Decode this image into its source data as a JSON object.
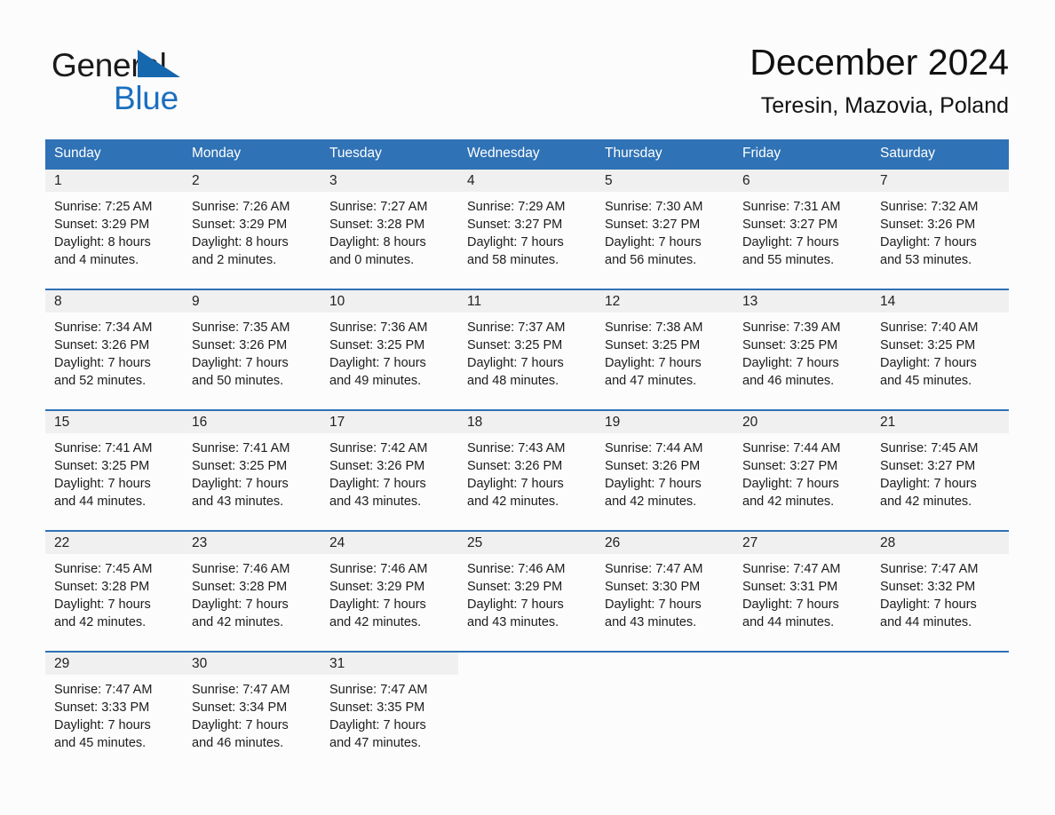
{
  "brand": {
    "line1": "General",
    "line2": "Blue",
    "triangle_color": "#1567ae",
    "blue_text_color": "#1b6fc0"
  },
  "header": {
    "title": "December 2024",
    "location": "Teresin, Mazovia, Poland"
  },
  "colors": {
    "header_blue": "#2f72b5",
    "daynum_band": "#f0f0f0",
    "page_background": "#fcfcfc",
    "text": "#1c1c1c"
  },
  "weekday_headers": [
    "Sunday",
    "Monday",
    "Tuesday",
    "Wednesday",
    "Thursday",
    "Friday",
    "Saturday"
  ],
  "weeks": [
    {
      "days": [
        {
          "num": "1",
          "sunrise": "Sunrise: 7:25 AM",
          "sunset": "Sunset: 3:29 PM",
          "daylight1": "Daylight: 8 hours",
          "daylight2": "and 4 minutes."
        },
        {
          "num": "2",
          "sunrise": "Sunrise: 7:26 AM",
          "sunset": "Sunset: 3:29 PM",
          "daylight1": "Daylight: 8 hours",
          "daylight2": "and 2 minutes."
        },
        {
          "num": "3",
          "sunrise": "Sunrise: 7:27 AM",
          "sunset": "Sunset: 3:28 PM",
          "daylight1": "Daylight: 8 hours",
          "daylight2": "and 0 minutes."
        },
        {
          "num": "4",
          "sunrise": "Sunrise: 7:29 AM",
          "sunset": "Sunset: 3:27 PM",
          "daylight1": "Daylight: 7 hours",
          "daylight2": "and 58 minutes."
        },
        {
          "num": "5",
          "sunrise": "Sunrise: 7:30 AM",
          "sunset": "Sunset: 3:27 PM",
          "daylight1": "Daylight: 7 hours",
          "daylight2": "and 56 minutes."
        },
        {
          "num": "6",
          "sunrise": "Sunrise: 7:31 AM",
          "sunset": "Sunset: 3:27 PM",
          "daylight1": "Daylight: 7 hours",
          "daylight2": "and 55 minutes."
        },
        {
          "num": "7",
          "sunrise": "Sunrise: 7:32 AM",
          "sunset": "Sunset: 3:26 PM",
          "daylight1": "Daylight: 7 hours",
          "daylight2": "and 53 minutes."
        }
      ]
    },
    {
      "days": [
        {
          "num": "8",
          "sunrise": "Sunrise: 7:34 AM",
          "sunset": "Sunset: 3:26 PM",
          "daylight1": "Daylight: 7 hours",
          "daylight2": "and 52 minutes."
        },
        {
          "num": "9",
          "sunrise": "Sunrise: 7:35 AM",
          "sunset": "Sunset: 3:26 PM",
          "daylight1": "Daylight: 7 hours",
          "daylight2": "and 50 minutes."
        },
        {
          "num": "10",
          "sunrise": "Sunrise: 7:36 AM",
          "sunset": "Sunset: 3:25 PM",
          "daylight1": "Daylight: 7 hours",
          "daylight2": "and 49 minutes."
        },
        {
          "num": "11",
          "sunrise": "Sunrise: 7:37 AM",
          "sunset": "Sunset: 3:25 PM",
          "daylight1": "Daylight: 7 hours",
          "daylight2": "and 48 minutes."
        },
        {
          "num": "12",
          "sunrise": "Sunrise: 7:38 AM",
          "sunset": "Sunset: 3:25 PM",
          "daylight1": "Daylight: 7 hours",
          "daylight2": "and 47 minutes."
        },
        {
          "num": "13",
          "sunrise": "Sunrise: 7:39 AM",
          "sunset": "Sunset: 3:25 PM",
          "daylight1": "Daylight: 7 hours",
          "daylight2": "and 46 minutes."
        },
        {
          "num": "14",
          "sunrise": "Sunrise: 7:40 AM",
          "sunset": "Sunset: 3:25 PM",
          "daylight1": "Daylight: 7 hours",
          "daylight2": "and 45 minutes."
        }
      ]
    },
    {
      "days": [
        {
          "num": "15",
          "sunrise": "Sunrise: 7:41 AM",
          "sunset": "Sunset: 3:25 PM",
          "daylight1": "Daylight: 7 hours",
          "daylight2": "and 44 minutes."
        },
        {
          "num": "16",
          "sunrise": "Sunrise: 7:41 AM",
          "sunset": "Sunset: 3:25 PM",
          "daylight1": "Daylight: 7 hours",
          "daylight2": "and 43 minutes."
        },
        {
          "num": "17",
          "sunrise": "Sunrise: 7:42 AM",
          "sunset": "Sunset: 3:26 PM",
          "daylight1": "Daylight: 7 hours",
          "daylight2": "and 43 minutes."
        },
        {
          "num": "18",
          "sunrise": "Sunrise: 7:43 AM",
          "sunset": "Sunset: 3:26 PM",
          "daylight1": "Daylight: 7 hours",
          "daylight2": "and 42 minutes."
        },
        {
          "num": "19",
          "sunrise": "Sunrise: 7:44 AM",
          "sunset": "Sunset: 3:26 PM",
          "daylight1": "Daylight: 7 hours",
          "daylight2": "and 42 minutes."
        },
        {
          "num": "20",
          "sunrise": "Sunrise: 7:44 AM",
          "sunset": "Sunset: 3:27 PM",
          "daylight1": "Daylight: 7 hours",
          "daylight2": "and 42 minutes."
        },
        {
          "num": "21",
          "sunrise": "Sunrise: 7:45 AM",
          "sunset": "Sunset: 3:27 PM",
          "daylight1": "Daylight: 7 hours",
          "daylight2": "and 42 minutes."
        }
      ]
    },
    {
      "days": [
        {
          "num": "22",
          "sunrise": "Sunrise: 7:45 AM",
          "sunset": "Sunset: 3:28 PM",
          "daylight1": "Daylight: 7 hours",
          "daylight2": "and 42 minutes."
        },
        {
          "num": "23",
          "sunrise": "Sunrise: 7:46 AM",
          "sunset": "Sunset: 3:28 PM",
          "daylight1": "Daylight: 7 hours",
          "daylight2": "and 42 minutes."
        },
        {
          "num": "24",
          "sunrise": "Sunrise: 7:46 AM",
          "sunset": "Sunset: 3:29 PM",
          "daylight1": "Daylight: 7 hours",
          "daylight2": "and 42 minutes."
        },
        {
          "num": "25",
          "sunrise": "Sunrise: 7:46 AM",
          "sunset": "Sunset: 3:29 PM",
          "daylight1": "Daylight: 7 hours",
          "daylight2": "and 43 minutes."
        },
        {
          "num": "26",
          "sunrise": "Sunrise: 7:47 AM",
          "sunset": "Sunset: 3:30 PM",
          "daylight1": "Daylight: 7 hours",
          "daylight2": "and 43 minutes."
        },
        {
          "num": "27",
          "sunrise": "Sunrise: 7:47 AM",
          "sunset": "Sunset: 3:31 PM",
          "daylight1": "Daylight: 7 hours",
          "daylight2": "and 44 minutes."
        },
        {
          "num": "28",
          "sunrise": "Sunrise: 7:47 AM",
          "sunset": "Sunset: 3:32 PM",
          "daylight1": "Daylight: 7 hours",
          "daylight2": "and 44 minutes."
        }
      ]
    },
    {
      "days": [
        {
          "num": "29",
          "sunrise": "Sunrise: 7:47 AM",
          "sunset": "Sunset: 3:33 PM",
          "daylight1": "Daylight: 7 hours",
          "daylight2": "and 45 minutes."
        },
        {
          "num": "30",
          "sunrise": "Sunrise: 7:47 AM",
          "sunset": "Sunset: 3:34 PM",
          "daylight1": "Daylight: 7 hours",
          "daylight2": "and 46 minutes."
        },
        {
          "num": "31",
          "sunrise": "Sunrise: 7:47 AM",
          "sunset": "Sunset: 3:35 PM",
          "daylight1": "Daylight: 7 hours",
          "daylight2": "and 47 minutes."
        },
        {
          "num": "",
          "sunrise": "",
          "sunset": "",
          "daylight1": "",
          "daylight2": ""
        },
        {
          "num": "",
          "sunrise": "",
          "sunset": "",
          "daylight1": "",
          "daylight2": ""
        },
        {
          "num": "",
          "sunrise": "",
          "sunset": "",
          "daylight1": "",
          "daylight2": ""
        },
        {
          "num": "",
          "sunrise": "",
          "sunset": "",
          "daylight1": "",
          "daylight2": ""
        }
      ]
    }
  ]
}
